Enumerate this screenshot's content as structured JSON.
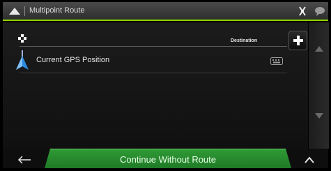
{
  "header": {
    "title": "Multipoint Route"
  },
  "route": {
    "destination_label": "Destination",
    "start_label": "Current GPS Position"
  },
  "footer": {
    "continue_label": "Continue Without Route"
  },
  "colors": {
    "accent": "#8fd400",
    "button_green": "#2a8d31",
    "gps_blue": "#2f8be0"
  },
  "icons": [
    "up-arrow-icon",
    "settings-icon",
    "chat-icon",
    "checkered-flag-icon",
    "plus-icon",
    "gps-arrow-icon",
    "keyboard-icon",
    "scroll-up-icon",
    "scroll-down-icon",
    "back-arrow-icon",
    "chevron-up-icon"
  ]
}
